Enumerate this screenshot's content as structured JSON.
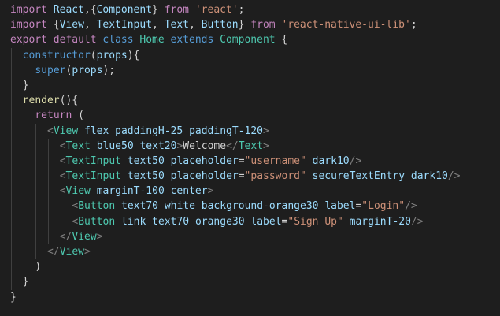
{
  "editor": {
    "background": "#1e1e1e",
    "lines": [
      {
        "indent": 0,
        "segs": [
          [
            "kw",
            "import"
          ],
          [
            "punc",
            " "
          ],
          [
            "id",
            "React"
          ],
          [
            "punc",
            ",{"
          ],
          [
            "id",
            "Component"
          ],
          [
            "punc",
            "} "
          ],
          [
            "kw",
            "from"
          ],
          [
            "punc",
            " "
          ],
          [
            "str",
            "'react'"
          ],
          [
            "punc",
            ";"
          ]
        ]
      },
      {
        "indent": 0,
        "segs": [
          [
            "kw",
            "import"
          ],
          [
            "punc",
            " {"
          ],
          [
            "id",
            "View"
          ],
          [
            "punc",
            ", "
          ],
          [
            "id",
            "TextInput"
          ],
          [
            "punc",
            ", "
          ],
          [
            "id",
            "Text"
          ],
          [
            "punc",
            ", "
          ],
          [
            "id",
            "Button"
          ],
          [
            "punc",
            "} "
          ],
          [
            "kw",
            "from"
          ],
          [
            "punc",
            " "
          ],
          [
            "str",
            "'react-native-ui-lib'"
          ],
          [
            "punc",
            ";"
          ]
        ]
      },
      {
        "indent": 0,
        "segs": [
          [
            "kw",
            "export"
          ],
          [
            "punc",
            " "
          ],
          [
            "kw",
            "default"
          ],
          [
            "punc",
            " "
          ],
          [
            "sk",
            "class"
          ],
          [
            "punc",
            " "
          ],
          [
            "cls",
            "Home"
          ],
          [
            "punc",
            " "
          ],
          [
            "sk",
            "extends"
          ],
          [
            "punc",
            " "
          ],
          [
            "cls",
            "Component"
          ],
          [
            "punc",
            " {"
          ]
        ]
      },
      {
        "indent": 1,
        "segs": [
          [
            "sk",
            "constructor"
          ],
          [
            "punc",
            "("
          ],
          [
            "id",
            "props"
          ],
          [
            "punc",
            "){"
          ]
        ]
      },
      {
        "indent": 2,
        "segs": [
          [
            "sk",
            "super"
          ],
          [
            "punc",
            "("
          ],
          [
            "id",
            "props"
          ],
          [
            "punc",
            ");"
          ]
        ]
      },
      {
        "indent": 1,
        "segs": [
          [
            "punc",
            "}"
          ]
        ]
      },
      {
        "indent": 1,
        "segs": [
          [
            "fn",
            "render"
          ],
          [
            "punc",
            "(){"
          ]
        ]
      },
      {
        "indent": 2,
        "segs": [
          [
            "kw",
            "return"
          ],
          [
            "punc",
            " ("
          ]
        ]
      },
      {
        "indent": 3,
        "segs": [
          [
            "brk",
            "<"
          ],
          [
            "tag",
            "View"
          ],
          [
            "punc",
            " "
          ],
          [
            "attr",
            "flex"
          ],
          [
            "punc",
            " "
          ],
          [
            "attr",
            "paddingH-25"
          ],
          [
            "punc",
            " "
          ],
          [
            "attr",
            "paddingT-120"
          ],
          [
            "brk",
            ">"
          ]
        ]
      },
      {
        "indent": 4,
        "segs": [
          [
            "brk",
            "<"
          ],
          [
            "tag",
            "Text"
          ],
          [
            "punc",
            " "
          ],
          [
            "attr",
            "blue50"
          ],
          [
            "punc",
            " "
          ],
          [
            "attr",
            "text20"
          ],
          [
            "brk",
            ">"
          ],
          [
            "txt",
            "Welcome"
          ],
          [
            "brk",
            "</"
          ],
          [
            "tag",
            "Text"
          ],
          [
            "brk",
            ">"
          ]
        ]
      },
      {
        "indent": 4,
        "segs": [
          [
            "brk",
            "<"
          ],
          [
            "tag",
            "TextInput"
          ],
          [
            "punc",
            " "
          ],
          [
            "attr",
            "text50"
          ],
          [
            "punc",
            " "
          ],
          [
            "attr",
            "placeholder"
          ],
          [
            "punc",
            "="
          ],
          [
            "str",
            "\"username\""
          ],
          [
            "punc",
            " "
          ],
          [
            "attr",
            "dark10"
          ],
          [
            "brk",
            "/>"
          ]
        ]
      },
      {
        "indent": 4,
        "segs": [
          [
            "brk",
            "<"
          ],
          [
            "tag",
            "TextInput"
          ],
          [
            "punc",
            " "
          ],
          [
            "attr",
            "text50"
          ],
          [
            "punc",
            " "
          ],
          [
            "attr",
            "placeholder"
          ],
          [
            "punc",
            "="
          ],
          [
            "str",
            "\"password\""
          ],
          [
            "punc",
            " "
          ],
          [
            "attr",
            "secureTextEntry"
          ],
          [
            "punc",
            " "
          ],
          [
            "attr",
            "dark10"
          ],
          [
            "brk",
            "/>"
          ]
        ]
      },
      {
        "indent": 4,
        "segs": [
          [
            "brk",
            "<"
          ],
          [
            "tag",
            "View"
          ],
          [
            "punc",
            " "
          ],
          [
            "attr",
            "marginT-100"
          ],
          [
            "punc",
            " "
          ],
          [
            "attr",
            "center"
          ],
          [
            "brk",
            ">"
          ]
        ]
      },
      {
        "indent": 5,
        "segs": [
          [
            "brk",
            "<"
          ],
          [
            "tag",
            "Button"
          ],
          [
            "punc",
            " "
          ],
          [
            "attr",
            "text70"
          ],
          [
            "punc",
            " "
          ],
          [
            "attr",
            "white"
          ],
          [
            "punc",
            " "
          ],
          [
            "attr",
            "background-orange30"
          ],
          [
            "punc",
            " "
          ],
          [
            "attr",
            "label"
          ],
          [
            "punc",
            "="
          ],
          [
            "str",
            "\"Login\""
          ],
          [
            "brk",
            "/>"
          ]
        ]
      },
      {
        "indent": 5,
        "segs": [
          [
            "brk",
            "<"
          ],
          [
            "tag",
            "Button"
          ],
          [
            "punc",
            " "
          ],
          [
            "attr",
            "link"
          ],
          [
            "punc",
            " "
          ],
          [
            "attr",
            "text70"
          ],
          [
            "punc",
            " "
          ],
          [
            "attr",
            "orange30"
          ],
          [
            "punc",
            " "
          ],
          [
            "attr",
            "label"
          ],
          [
            "punc",
            "="
          ],
          [
            "str",
            "\"Sign Up\""
          ],
          [
            "punc",
            " "
          ],
          [
            "attr",
            "marginT-20"
          ],
          [
            "brk",
            "/>"
          ]
        ]
      },
      {
        "indent": 4,
        "segs": [
          [
            "brk",
            "</"
          ],
          [
            "tag",
            "View"
          ],
          [
            "brk",
            ">"
          ]
        ]
      },
      {
        "indent": 3,
        "segs": [
          [
            "brk",
            "</"
          ],
          [
            "tag",
            "View"
          ],
          [
            "brk",
            ">"
          ]
        ]
      },
      {
        "indent": 2,
        "segs": [
          [
            "punc",
            ")"
          ]
        ]
      },
      {
        "indent": 1,
        "segs": [
          [
            "punc",
            "}"
          ]
        ]
      },
      {
        "indent": 0,
        "segs": [
          [
            "punc",
            "}"
          ]
        ]
      }
    ]
  }
}
